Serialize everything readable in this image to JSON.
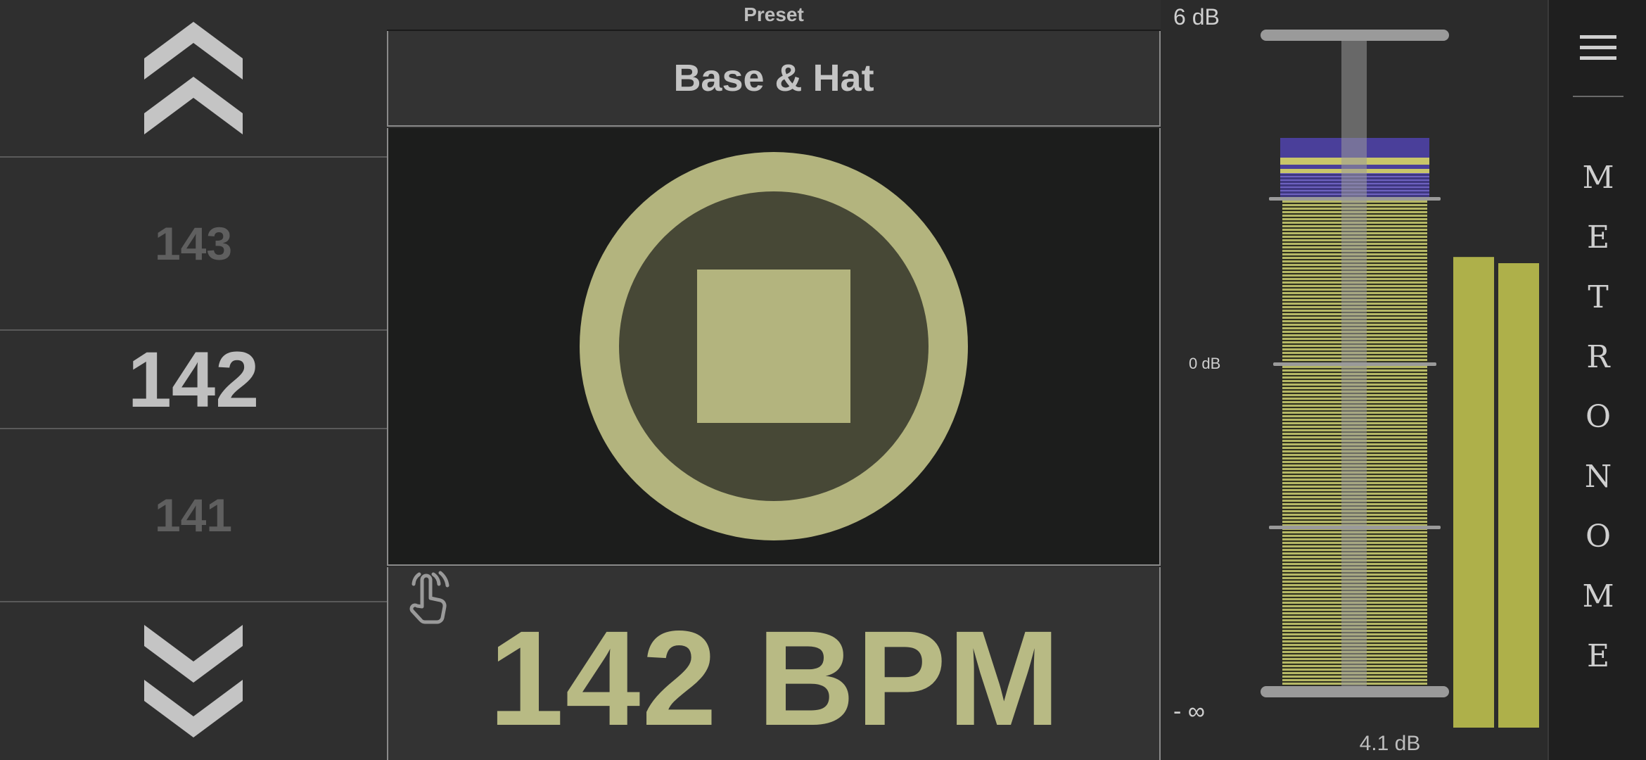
{
  "picker": {
    "up_icon": "double-chevron-up-icon",
    "down_icon": "double-chevron-down-icon",
    "above": "143",
    "current": "142",
    "below": "141"
  },
  "preset": {
    "label": "Preset",
    "name": "Base & Hat"
  },
  "player": {
    "state_icon": "stop-icon",
    "tap_icon": "tap-gesture-icon",
    "bpm_text": "142 BPM"
  },
  "meter": {
    "top_label": "6 dB",
    "mid_label": "0 dB",
    "bottom_label": "- ∞",
    "value_label": "4.1 dB",
    "level_left": 0.76,
    "level_right": 0.75
  },
  "sidebar": {
    "menu_icon": "hamburger-menu-icon",
    "title_letters": [
      "M",
      "E",
      "T",
      "R",
      "O",
      "N",
      "O",
      "M",
      "E"
    ]
  },
  "colors": {
    "accent": "#b3b47e",
    "meter_yellow": "#aeb04a",
    "meter_purple": "#4a3f9a"
  }
}
